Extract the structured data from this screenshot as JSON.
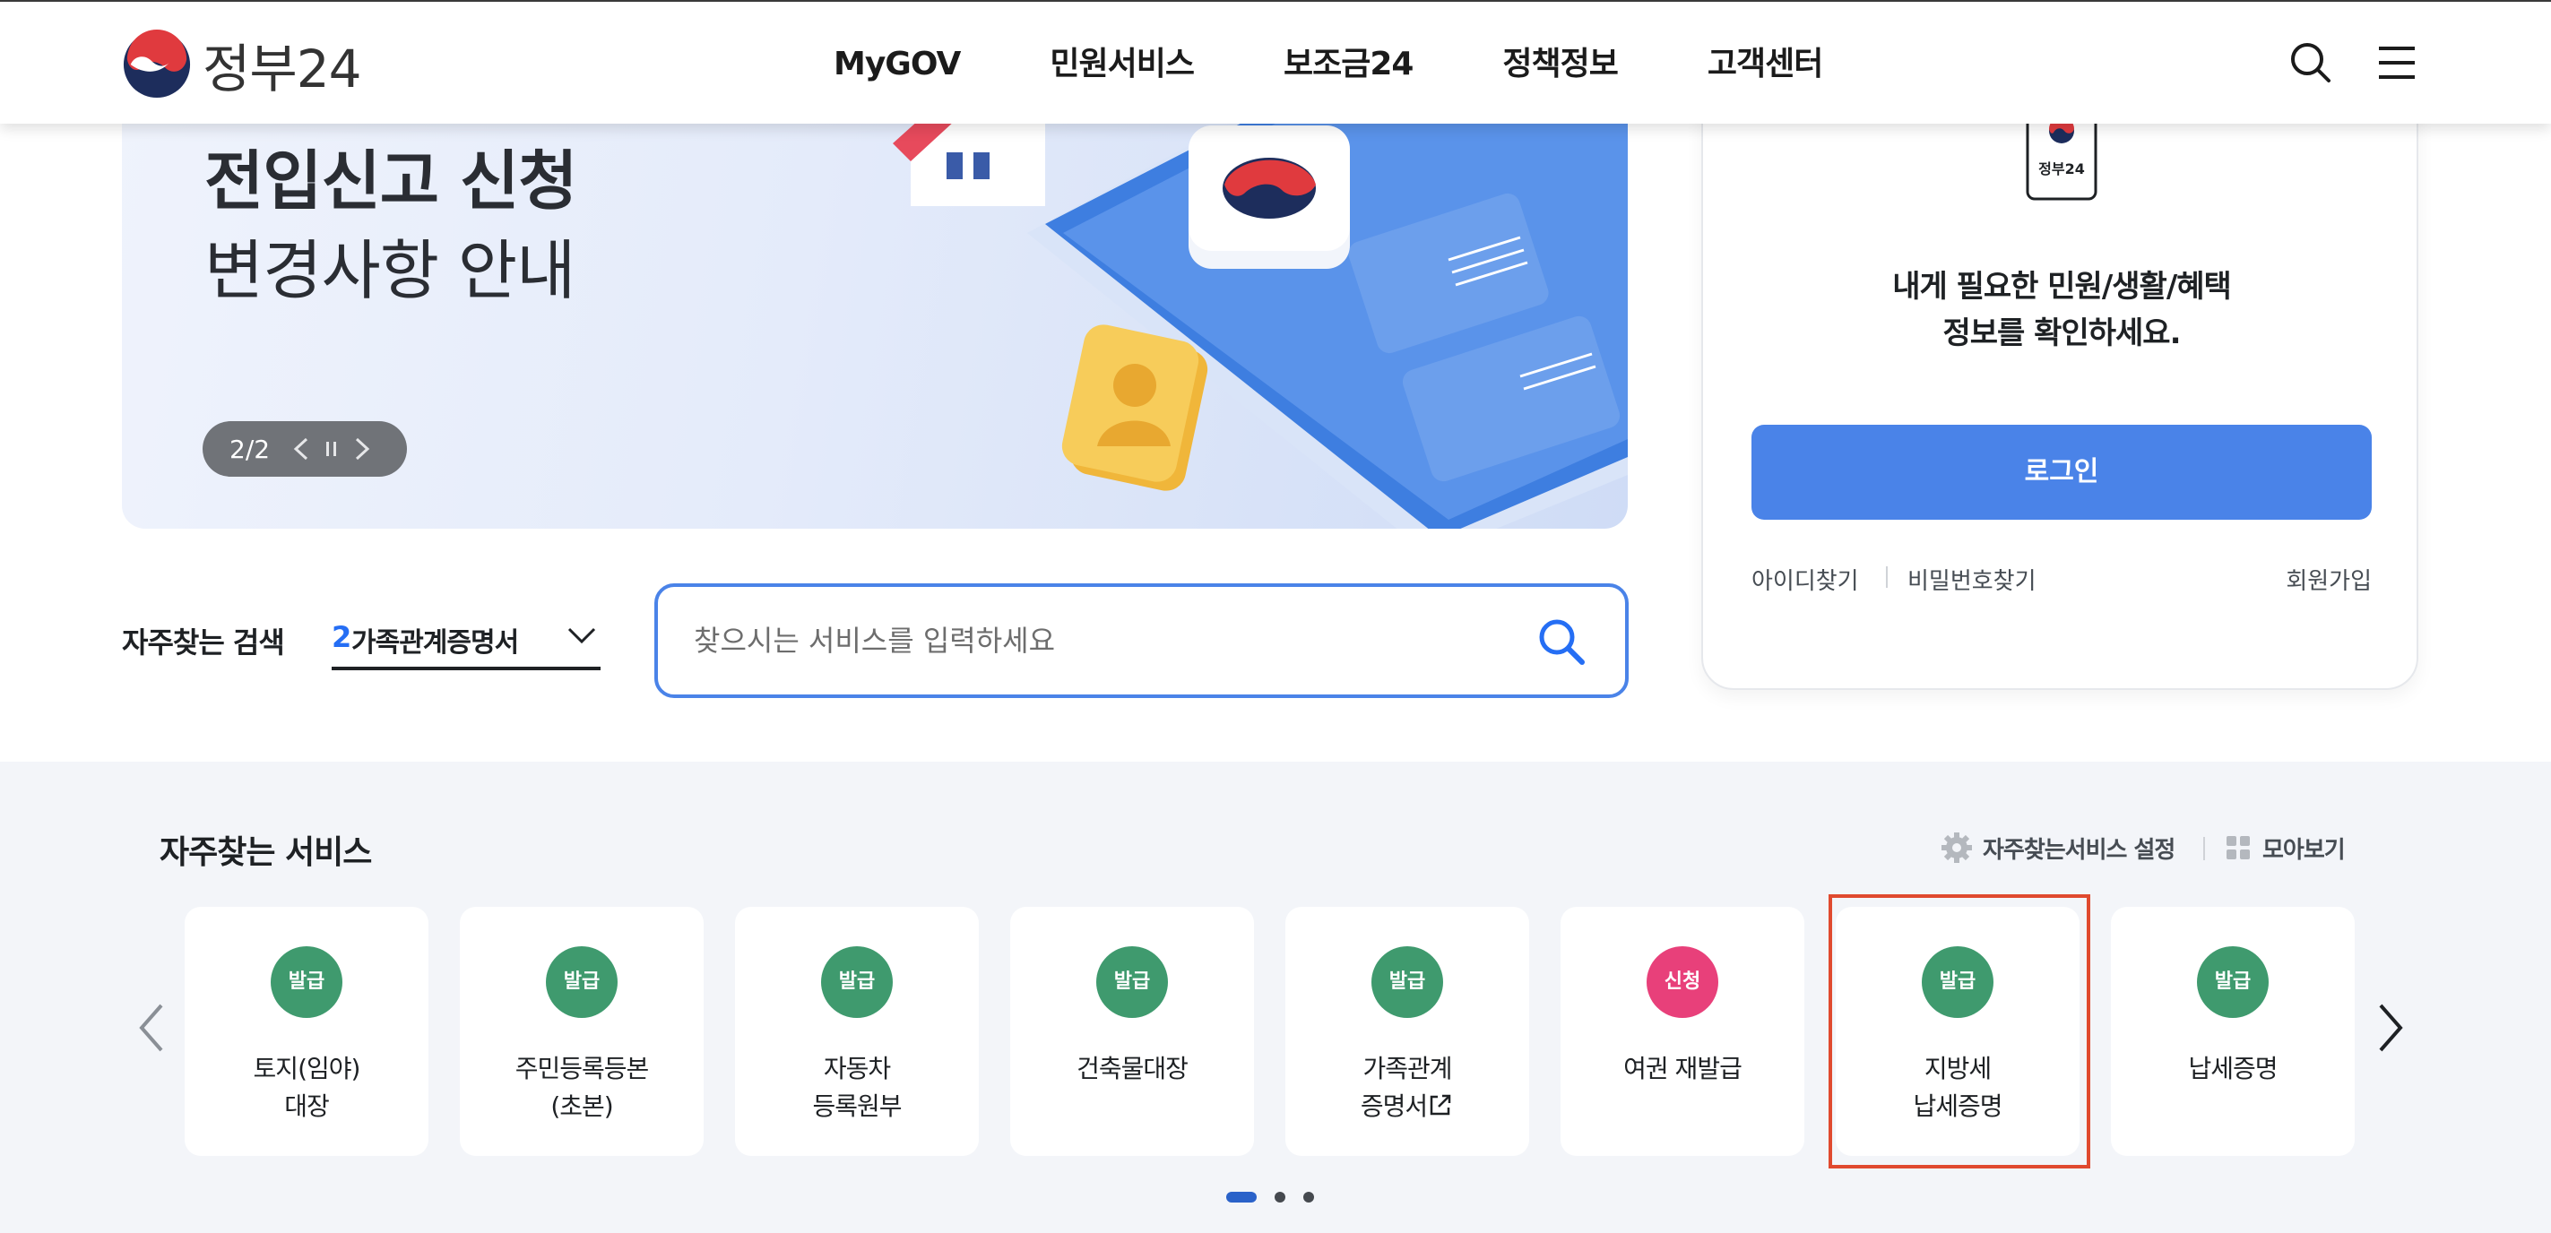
{
  "header": {
    "logo_text": "정부24",
    "nav": [
      "MyGOV",
      "민원서비스",
      "보조금24",
      "정책정보",
      "고객센터"
    ],
    "search_icon": "search-icon",
    "menu_icon": "hamburger-menu-icon"
  },
  "banner": {
    "title_line1": "전입신고 신청",
    "title_line2": "변경사항 안내",
    "counter": "2/2",
    "controls": [
      "chevron-left-icon",
      "pause-icon",
      "chevron-right-icon"
    ]
  },
  "frequent_search": {
    "label": "자주찾는 검색",
    "rank": "2",
    "selected": "가족관계증명서",
    "placeholder": "찾으시는 서비스를 입력하세요"
  },
  "login": {
    "app_icon_text": "정부24",
    "message_line1": "내게 필요한 민원/생활/혜택",
    "message_line2": "정보를 확인하세요.",
    "button": "로그인",
    "find_id": "아이디찾기",
    "find_password": "비밀번호찾기",
    "signup": "회원가입"
  },
  "favorites": {
    "title": "자주찾는 서비스",
    "setting_label": "자주찾는서비스 설정",
    "view_all_label": "모아보기",
    "colors": {
      "issue": "#3f9a6e",
      "apply": "#e8407a",
      "highlight": "#e04a2f"
    },
    "items": [
      {
        "badge": "발급",
        "type": "issue",
        "label": "토지(임야)\n대장"
      },
      {
        "badge": "발급",
        "type": "issue",
        "label": "주민등록등본\n(초본)"
      },
      {
        "badge": "발급",
        "type": "issue",
        "label": "자동차\n등록원부"
      },
      {
        "badge": "발급",
        "type": "issue",
        "label": "건축물대장"
      },
      {
        "badge": "발급",
        "type": "issue",
        "label": "가족관계\n증명서"
      },
      {
        "badge": "신청",
        "type": "apply",
        "label": "여권 재발급"
      },
      {
        "badge": "발급",
        "type": "issue",
        "label": "지방세\n납세증명"
      },
      {
        "badge": "발급",
        "type": "issue",
        "label": "납세증명"
      }
    ],
    "page_count": 3,
    "active_page": 1
  }
}
